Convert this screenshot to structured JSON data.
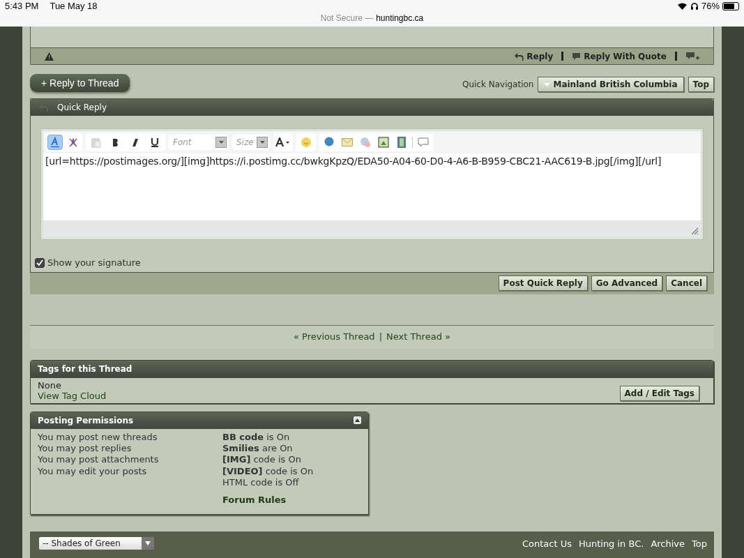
{
  "status_bar": {
    "time": "5:43 PM",
    "date": "Tue May 18",
    "battery": "76%"
  },
  "address_bar": {
    "security": "Not Secure —",
    "domain": "huntingbc.ca"
  },
  "post_actions": [
    "Reply",
    "Reply With Quote"
  ],
  "reply_to_thread": "+ Reply to Thread",
  "quick_navigation": {
    "label": "Quick Navigation",
    "forum": "Mainland British Columbia",
    "top": "Top"
  },
  "quick_reply": {
    "title": "Quick Reply",
    "editor": {
      "wysiwyg": true,
      "font_placeholder": "Font",
      "size_placeholder": "Size",
      "text": "[url=https://postimages.org/][img]https://i.postimg.cc/bwkgKpzQ/EDA50-A04-60-D0-4-A6-B-B959-CBC21-AAC619-B.jpg[/img][/url]"
    },
    "show_signature": {
      "label": "Show your signature",
      "checked": true
    },
    "buttons": [
      "Post Quick Reply",
      "Go Advanced",
      "Cancel"
    ]
  },
  "thread_nav": {
    "previous": "« Previous Thread",
    "separator": "|",
    "next": "Next Thread »"
  },
  "tags": {
    "title": "Tags for this Thread",
    "value": "None",
    "cloud_link": "View Tag Cloud",
    "edit_button": "Add / Edit Tags"
  },
  "posting_permissions": {
    "title": "Posting Permissions",
    "expanded": true,
    "left": [
      "You may post new threads",
      "You may post replies",
      "You may post attachments",
      "You may edit your posts"
    ],
    "right": [
      "**BB code** is On",
      "**Smilies** are On",
      "**[IMG]** code is On",
      "**[VIDEO]** code is On",
      "HTML code is Off"
    ],
    "rules_link": "Forum Rules"
  },
  "footer": {
    "style_select": "-- Shades of Green",
    "links": [
      "Contact Us",
      "Hunting in BC.",
      "Archive",
      "Top"
    ]
  }
}
